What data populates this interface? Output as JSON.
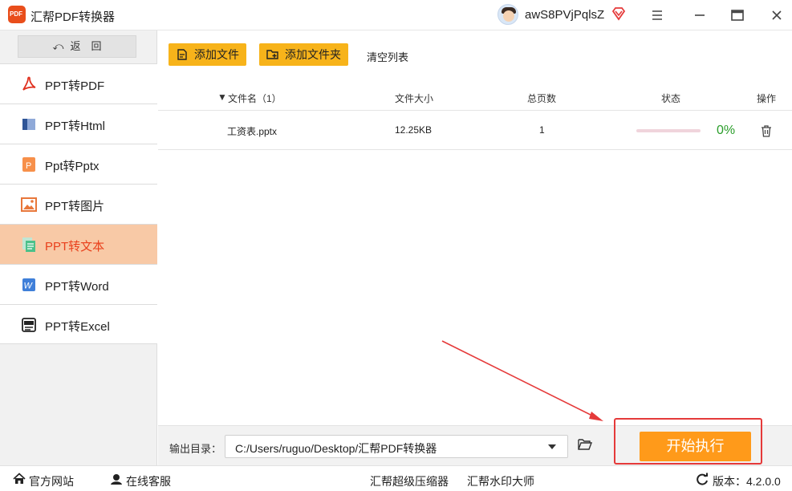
{
  "window": {
    "title": "汇帮PDF转换器",
    "username": "awS8PVjPqlsZ",
    "logo_text": "PDF"
  },
  "sidebar": {
    "back_label": "返　回",
    "items": [
      {
        "label": "PPT转PDF",
        "icon": "pdf-icon",
        "active": false
      },
      {
        "label": "PPT转Html",
        "icon": "html-icon",
        "active": false
      },
      {
        "label": "Ppt转Pptx",
        "icon": "pptx-icon",
        "active": false
      },
      {
        "label": "PPT转图片",
        "icon": "image-icon",
        "active": false
      },
      {
        "label": "PPT转文本",
        "icon": "text-icon",
        "active": true
      },
      {
        "label": "PPT转Word",
        "icon": "word-icon",
        "active": false
      },
      {
        "label": "PPT转Excel",
        "icon": "excel-icon",
        "active": false
      }
    ]
  },
  "toolbar": {
    "add_file": "添加文件",
    "add_folder": "添加文件夹",
    "clear_list": "清空列表"
  },
  "table": {
    "headers": {
      "filename": "文件名（1）",
      "size": "文件大小",
      "pages": "总页数",
      "status": "状态",
      "action": "操作"
    },
    "rows": [
      {
        "filename": "工资表.pptx",
        "size": "12.25KB",
        "pages": "1",
        "progress": 0,
        "percent": "0%"
      }
    ]
  },
  "output": {
    "label": "输出目录：",
    "path": "C:/Users/ruguo/Desktop/汇帮PDF转换器",
    "start_label": "开始执行"
  },
  "statusbar": {
    "website": "官方网站",
    "service": "在线客服",
    "compressor": "汇帮超级压缩器",
    "watermark": "汇帮水印大师",
    "version": "版本：4.2.0.0"
  },
  "colors": {
    "accent_orange": "#f7b31a",
    "start_button": "#ff9a1a",
    "active_nav_bg": "#f8c9a6",
    "active_nav_text": "#e9401c",
    "annotation_red": "#e53a3a",
    "percent_green": "#2a9d2a"
  }
}
